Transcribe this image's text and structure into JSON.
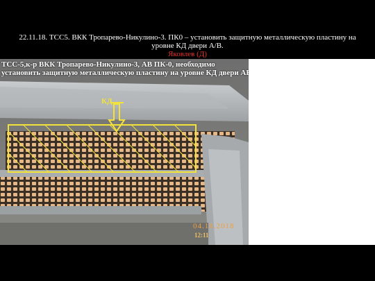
{
  "header": {
    "title": "22.11.18. ТСС5. ВКК Тропарево-Никулино-3. ПК0 – установить защитную металлическую пластину на уровне КД двери А/В.",
    "author": "Яковлев (Д)"
  },
  "photo": {
    "caption_line1": "ТСС-5,к-р ВКК Тропарево-Никулино-3, АВ ПК-0, необходимо",
    "caption_line2": "установить защитную металлическую пластину на уровне КД двери АВ",
    "marker_label": "КД",
    "date_stamp": "04.10.2018",
    "time_stamp": "12:11"
  },
  "colors": {
    "background": "#000000",
    "title_text": "#ffffff",
    "author_text": "#e8332e",
    "highlight": "#f2e23a"
  }
}
